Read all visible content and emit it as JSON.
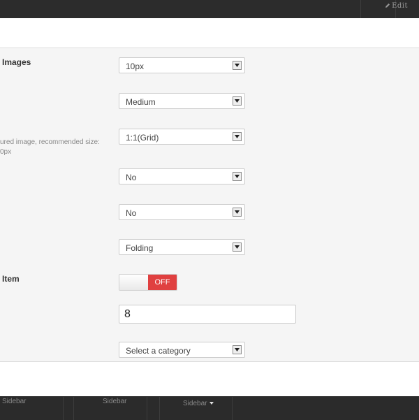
{
  "topbar": {
    "edit_label": "Edit"
  },
  "fields": {
    "images_label": "Images",
    "featured_desc_line1": "ured image, recommended size:",
    "featured_desc_line2": "0px",
    "item_label": "Item",
    "select_1_value": "10px",
    "select_2_value": "Medium",
    "select_3_value": "1:1(Grid)",
    "select_4_value": "No",
    "select_5_value": "No",
    "select_6_value": "Folding",
    "toggle_state": "OFF",
    "number_value": "8",
    "category_placeholder": "Select a category"
  },
  "bottombar": {
    "sidebar_1": "Sidebar",
    "sidebar_2": "Sidebar",
    "sidebar_3": "Sidebar"
  },
  "colors": {
    "toggle_off": "#e04040",
    "overlay": "#3a3a3a"
  }
}
